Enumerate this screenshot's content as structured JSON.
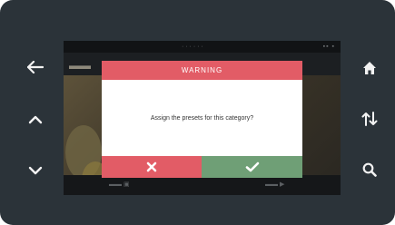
{
  "device": {
    "left_buttons": [
      {
        "icon": "arrow-left-icon"
      },
      {
        "icon": "chevron-up-icon"
      },
      {
        "icon": "chevron-down-icon"
      }
    ],
    "right_buttons": [
      {
        "icon": "home-icon"
      },
      {
        "icon": "sort-arrows-icon"
      },
      {
        "icon": "search-icon"
      }
    ]
  },
  "dialog": {
    "title": "WARNING",
    "message": "Assign the presets for this category?",
    "cancel_icon": "close-icon",
    "confirm_icon": "check-icon"
  },
  "colors": {
    "bezel": "#2b3339",
    "warning_red": "#e25c66",
    "confirm_green": "#6f9f76",
    "dialog_bg": "#ffffff"
  }
}
